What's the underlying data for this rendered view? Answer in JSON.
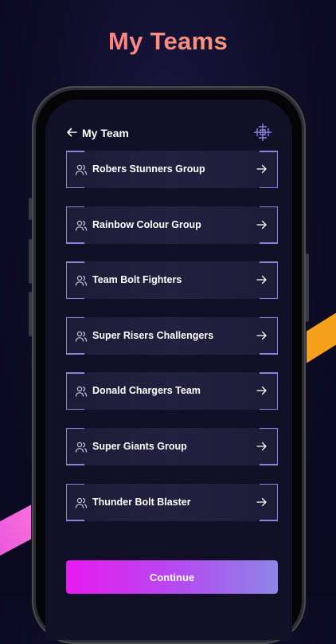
{
  "headline": "My Teams",
  "topbar": {
    "title": "My Team",
    "back_icon": "arrow-left-icon",
    "logo_icon": "team-logo-icon"
  },
  "teams": [
    {
      "label": "Robers Stunners Group"
    },
    {
      "label": "Rainbow Colour Group"
    },
    {
      "label": "Team Bolt Fighters"
    },
    {
      "label": "Super Risers Challengers"
    },
    {
      "label": "Donald Chargers Team"
    },
    {
      "label": "Super Giants Group"
    },
    {
      "label": "Thunder Bolt Blaster"
    }
  ],
  "continue_label": "Continue",
  "colors": {
    "accent_start": "#e81af0",
    "accent_end": "#8d86e6",
    "card_border": "#8a83d8",
    "headline_gradient_start": "#ff7a8a",
    "stripe_orange": "#f5a11c"
  }
}
